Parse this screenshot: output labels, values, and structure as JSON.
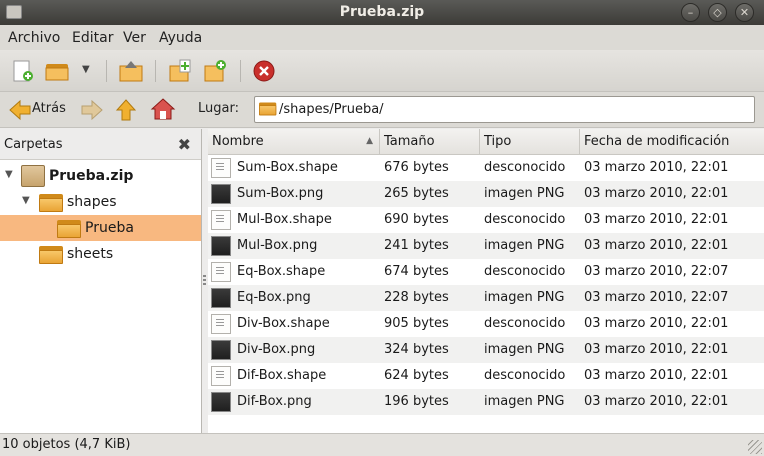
{
  "window": {
    "title": "Prueba.zip"
  },
  "menu": [
    {
      "label": "Archivo"
    },
    {
      "label": "Editar"
    },
    {
      "label": "Ver"
    },
    {
      "label": "Ayuda"
    }
  ],
  "nav": {
    "back_label": "Atrás",
    "location_label": "Lugar:",
    "location_value": "/shapes/Prueba/"
  },
  "sidebar": {
    "title": "Carpetas",
    "tree": [
      {
        "label": "Prueba.zip"
      },
      {
        "label": "shapes"
      },
      {
        "label": "Prueba"
      },
      {
        "label": "sheets"
      }
    ]
  },
  "columns": [
    {
      "label": "Nombre"
    },
    {
      "label": "Tamaño"
    },
    {
      "label": "Tipo"
    },
    {
      "label": "Fecha de modificación"
    }
  ],
  "sort_indicator": "▲",
  "files": [
    {
      "name": "Sum-Box.shape",
      "size": "676 bytes",
      "type": "desconocido",
      "date": "03 marzo 2010, 22:01",
      "icon": "document-icon"
    },
    {
      "name": "Sum-Box.png",
      "size": "265 bytes",
      "type": "imagen PNG",
      "date": "03 marzo 2010, 22:01",
      "icon": "image-icon"
    },
    {
      "name": "Mul-Box.shape",
      "size": "690 bytes",
      "type": "desconocido",
      "date": "03 marzo 2010, 22:01",
      "icon": "document-icon"
    },
    {
      "name": "Mul-Box.png",
      "size": "241 bytes",
      "type": "imagen PNG",
      "date": "03 marzo 2010, 22:01",
      "icon": "image-icon"
    },
    {
      "name": "Eq-Box.shape",
      "size": "674 bytes",
      "type": "desconocido",
      "date": "03 marzo 2010, 22:07",
      "icon": "document-icon"
    },
    {
      "name": "Eq-Box.png",
      "size": "228 bytes",
      "type": "imagen PNG",
      "date": "03 marzo 2010, 22:07",
      "icon": "image-icon"
    },
    {
      "name": "Div-Box.shape",
      "size": "905 bytes",
      "type": "desconocido",
      "date": "03 marzo 2010, 22:01",
      "icon": "document-icon"
    },
    {
      "name": "Div-Box.png",
      "size": "324 bytes",
      "type": "imagen PNG",
      "date": "03 marzo 2010, 22:01",
      "icon": "image-icon"
    },
    {
      "name": "Dif-Box.shape",
      "size": "624 bytes",
      "type": "desconocido",
      "date": "03 marzo 2010, 22:01",
      "icon": "document-icon"
    },
    {
      "name": "Dif-Box.png",
      "size": "196 bytes",
      "type": "imagen PNG",
      "date": "03 marzo 2010, 22:01",
      "icon": "image-icon"
    }
  ],
  "status": {
    "text": "10 objetos (4,7 KiB)"
  },
  "colors": {
    "selection": "#f8b880",
    "titlebar": "#3c3b37",
    "folder": "#e9a435"
  }
}
